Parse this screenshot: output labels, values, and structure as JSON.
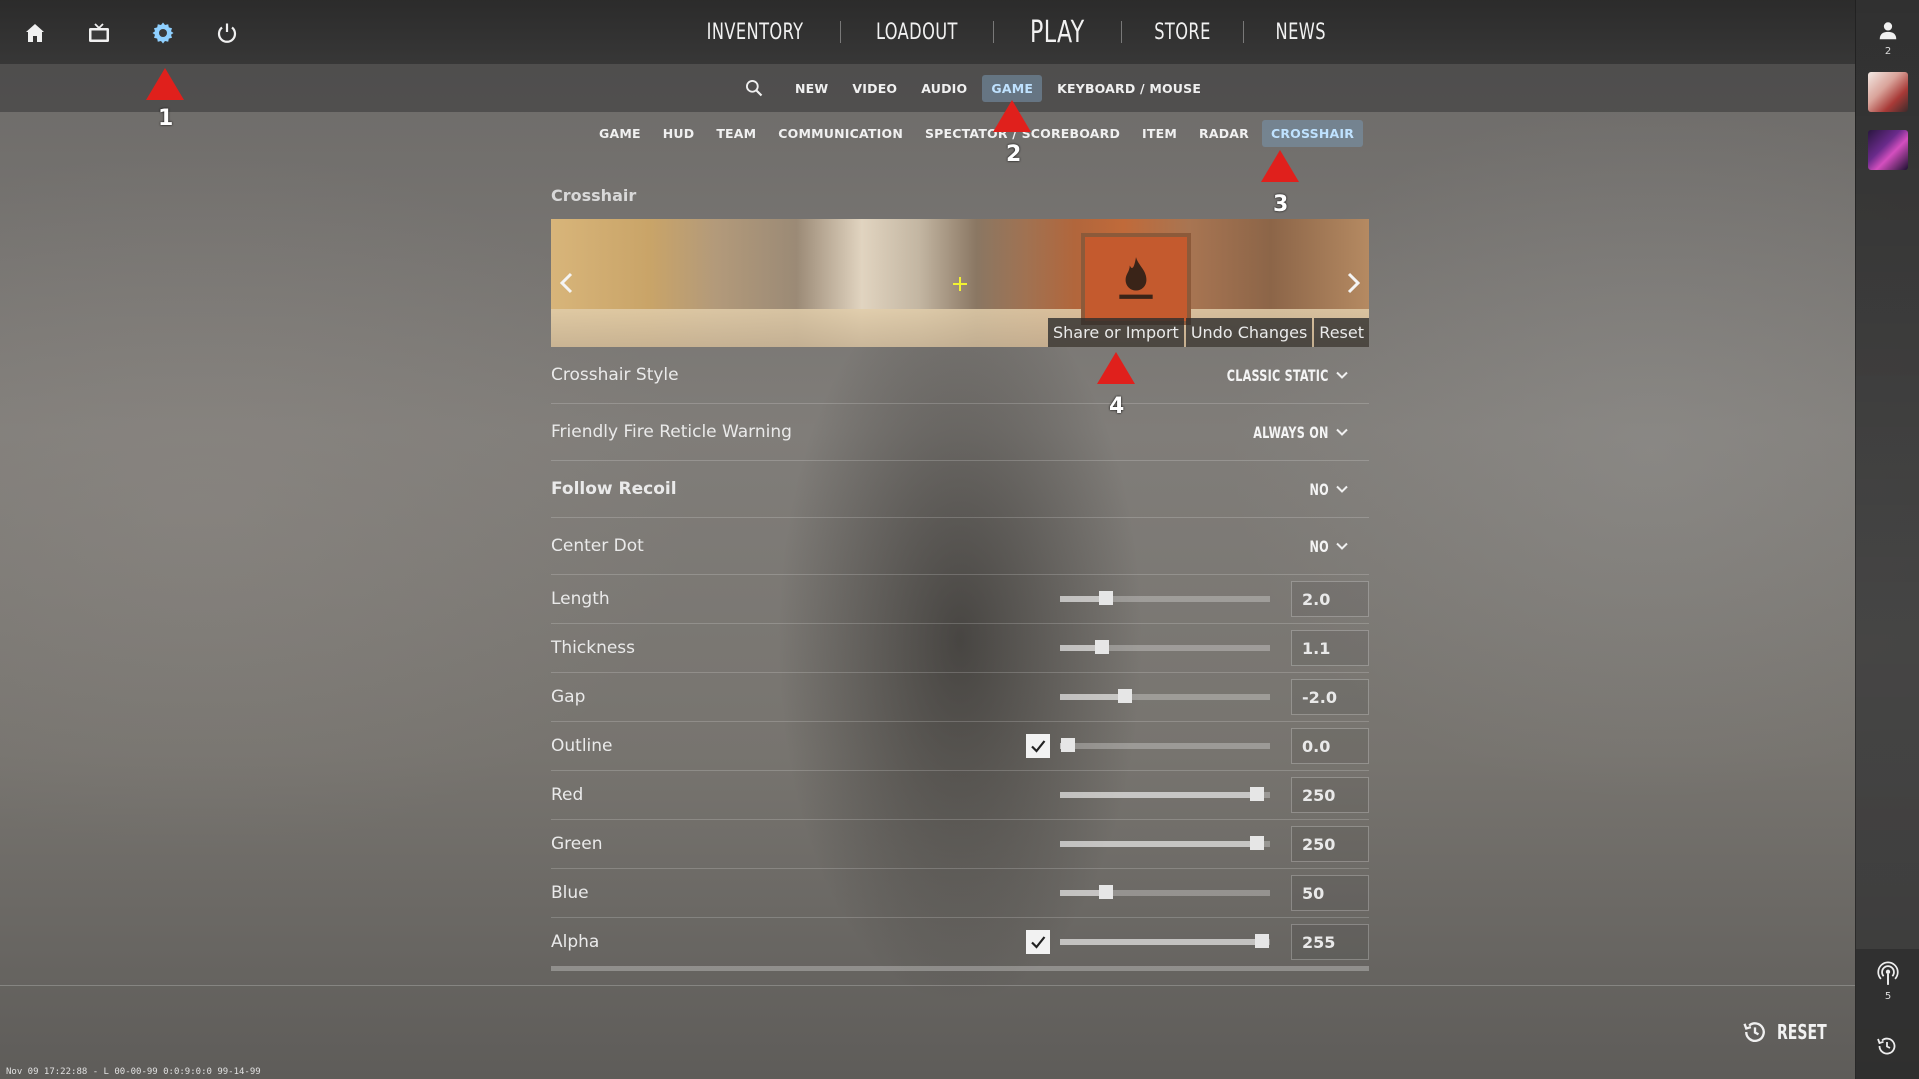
{
  "topbar": {
    "icons": [
      "home-icon",
      "tv-icon",
      "settings-gear-icon",
      "power-icon"
    ],
    "nav": [
      "INVENTORY",
      "LOADOUT",
      "PLAY",
      "STORE",
      "NEWS"
    ]
  },
  "rightbar": {
    "friends_count": "2",
    "signal_count": "5"
  },
  "settings_tabs": [
    "NEW",
    "VIDEO",
    "AUDIO",
    "GAME",
    "KEYBOARD / MOUSE"
  ],
  "game_subtabs": [
    "GAME",
    "HUD",
    "TEAM",
    "COMMUNICATION",
    "SPECTATOR / SCOREBOARD",
    "ITEM",
    "RADAR",
    "CROSSHAIR"
  ],
  "section_title": "Crosshair",
  "preview_actions": [
    "Share or Import",
    "Undo Changes",
    "Reset"
  ],
  "dropdowns": [
    {
      "label": "Crosshair Style",
      "value": "CLASSIC STATIC",
      "bold": false
    },
    {
      "label": "Friendly Fire Reticle Warning",
      "value": "ALWAYS ON",
      "bold": false
    },
    {
      "label": "Follow Recoil",
      "value": "NO",
      "bold": true
    },
    {
      "label": "Center Dot",
      "value": "NO",
      "bold": false
    }
  ],
  "sliders": [
    {
      "label": "Length",
      "value": "2.0",
      "level": 0.22,
      "checkbox": false
    },
    {
      "label": "Thickness",
      "value": "1.1",
      "level": 0.2,
      "checkbox": false
    },
    {
      "label": "Gap",
      "value": "-2.0",
      "level": 0.31,
      "checkbox": false
    },
    {
      "label": "Outline",
      "value": "0.0",
      "level": 0.04,
      "checkbox": true
    },
    {
      "label": "Red",
      "value": "250",
      "level": 0.94,
      "checkbox": false
    },
    {
      "label": "Green",
      "value": "250",
      "level": 0.94,
      "checkbox": false
    },
    {
      "label": "Blue",
      "value": "50",
      "level": 0.22,
      "checkbox": false
    },
    {
      "label": "Alpha",
      "value": "255",
      "level": 0.96,
      "checkbox": true
    }
  ],
  "reset_label": "RESET",
  "footer_text": "Nov 09 17:22:88 - L 00-00-99 0:0:9:0:0 99-14-99",
  "annotations": [
    "1",
    "2",
    "3",
    "4"
  ],
  "colors": {
    "active_tab_text": "#bfe2ff",
    "marker": "#e0201c",
    "crosshair_preview": "#f2f232"
  }
}
